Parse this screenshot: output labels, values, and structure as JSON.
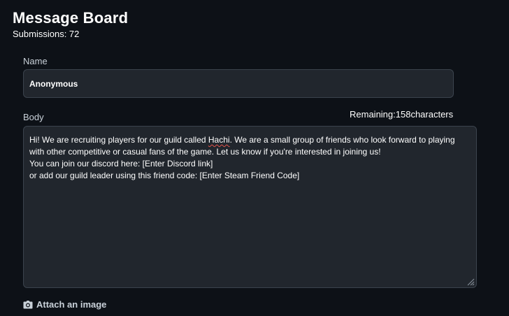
{
  "header": {
    "title": "Message Board",
    "submissions": "Submissions: 72"
  },
  "form": {
    "name_label": "Name",
    "name_value": "Anonymous",
    "body_label": "Body",
    "remaining": "Remaining:158characters",
    "body_lines": {
      "l1_pre": "Hi! We are recruiting players for our guild called ",
      "l1_word": "Hachi",
      "l1_post": ". We are a small group of friends who look forward to playing",
      "l2": "with other competitive or casual fans of the game. Let us know if you're interested in joining us!",
      "l3": "You can join our discord here: [Enter Discord link]",
      "l4": "or add our guild leader using this friend code: [Enter Steam Friend Code]"
    },
    "attach_label": "Attach an image",
    "attach_icon": "camera-icon"
  }
}
